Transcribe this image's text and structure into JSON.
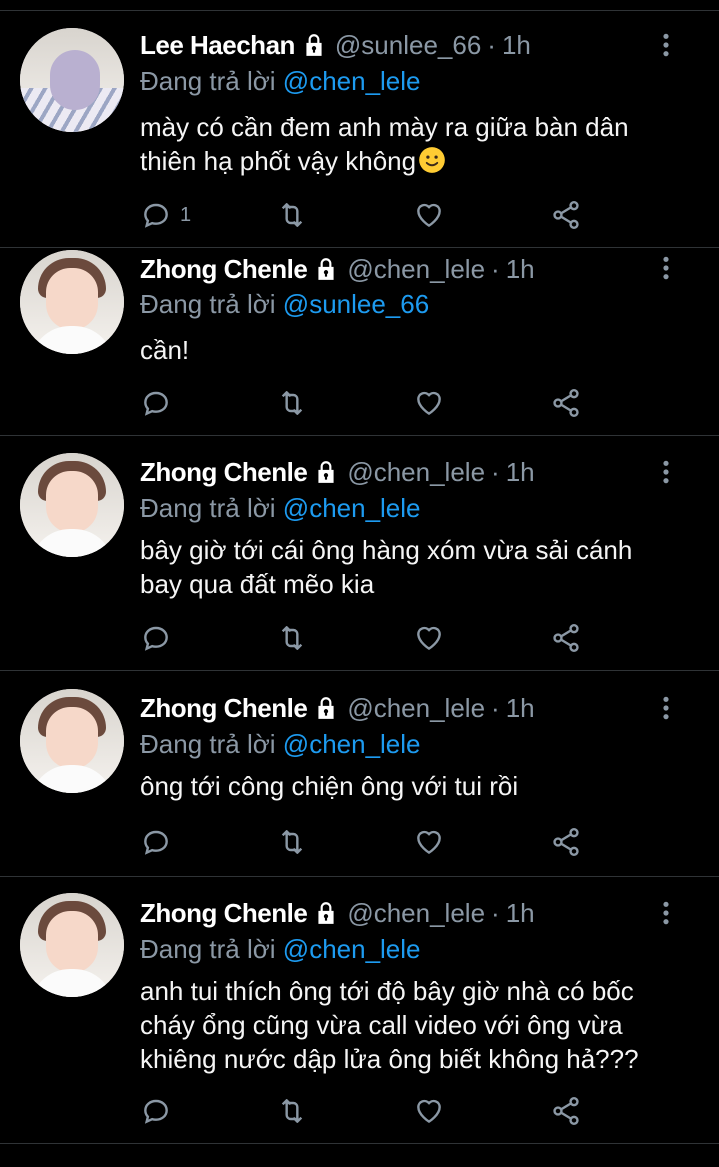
{
  "tweets": [
    {
      "name": "Lee Haechan",
      "handle": "@sunlee_66",
      "time": "1h",
      "reply_prefix": "Đang trả lời",
      "reply_to": "@chen_lele",
      "lines": [
        "mày có cần đem anh mày ra giữa bàn dân",
        "thiên hạ phốt vậy không"
      ],
      "emoji": "slightly-smiling-face",
      "reply_count": "1"
    },
    {
      "name": "Zhong Chenle",
      "handle": "@chen_lele",
      "time": "1h",
      "reply_prefix": "Đang trả lời",
      "reply_to": "@sunlee_66",
      "lines": [
        "cần!"
      ],
      "reply_count": ""
    },
    {
      "name": "Zhong Chenle",
      "handle": "@chen_lele",
      "time": "1h",
      "reply_prefix": "Đang trả lời",
      "reply_to": "@chen_lele",
      "lines": [
        "bây giờ tới cái ông hàng xóm vừa sải cánh",
        "bay qua đất mẽo kia"
      ],
      "reply_count": ""
    },
    {
      "name": "Zhong Chenle",
      "handle": "@chen_lele",
      "time": "1h",
      "reply_prefix": "Đang trả lời",
      "reply_to": "@chen_lele",
      "lines": [
        "ông tới công chiện ông với tui rồi"
      ],
      "reply_count": ""
    },
    {
      "name": "Zhong Chenle",
      "handle": "@chen_lele",
      "time": "1h",
      "reply_prefix": "Đang trả lời",
      "reply_to": "@chen_lele",
      "lines": [
        "anh tui thích ông tới độ bây giờ nhà có bốc",
        "cháy ổng cũng vừa call video với ông vừa",
        "khiêng nước dập lửa ông biết không hả???"
      ],
      "reply_count": ""
    }
  ],
  "colors": {
    "background": "#000000",
    "muted": "#8b98a5",
    "mention": "#1d9bf0",
    "divider": "#2f3336"
  }
}
